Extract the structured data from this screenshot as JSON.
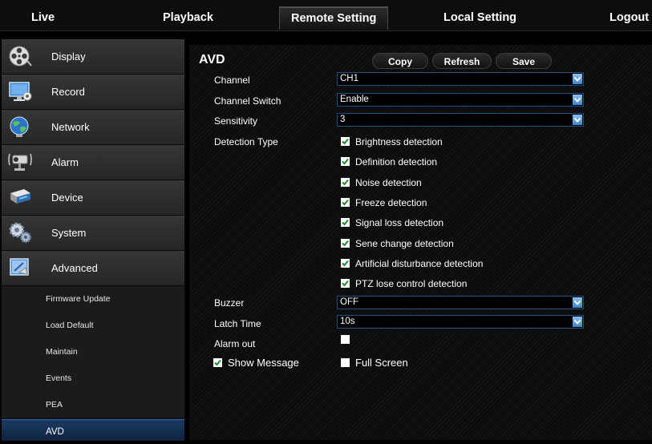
{
  "nav": {
    "tabs": [
      {
        "label": "Live"
      },
      {
        "label": "Playback"
      },
      {
        "label": "Remote Setting"
      },
      {
        "label": "Local Setting"
      },
      {
        "label": "Logout"
      }
    ],
    "active_tab": "Remote Setting"
  },
  "sidebar": {
    "items": [
      {
        "label": "Display",
        "icon": "film-reel-icon"
      },
      {
        "label": "Record",
        "icon": "monitor-record-icon"
      },
      {
        "label": "Network",
        "icon": "globe-icon"
      },
      {
        "label": "Alarm",
        "icon": "camera-alarm-icon"
      },
      {
        "label": "Device",
        "icon": "hard-drive-icon"
      },
      {
        "label": "System",
        "icon": "gears-icon"
      },
      {
        "label": "Advanced",
        "icon": "advanced-settings-icon"
      }
    ],
    "subitems": [
      {
        "label": "Firmware Update"
      },
      {
        "label": "Load Default"
      },
      {
        "label": "Maintain"
      },
      {
        "label": "Events"
      },
      {
        "label": "PEA"
      },
      {
        "label": "AVD"
      }
    ],
    "active_subitem": "AVD"
  },
  "main": {
    "title": "AVD",
    "buttons": {
      "copy": "Copy",
      "refresh": "Refresh",
      "save": "Save"
    },
    "channel": {
      "label": "Channel",
      "value": "CH1"
    },
    "channel_switch": {
      "label": "Channel Switch",
      "value": "Enable"
    },
    "sensitivity": {
      "label": "Sensitivity",
      "value": "3"
    },
    "detection_type": {
      "label": "Detection Type",
      "options": [
        {
          "label": "Brightness detection",
          "checked": true
        },
        {
          "label": "Definition detection",
          "checked": true
        },
        {
          "label": "Noise detection",
          "checked": true
        },
        {
          "label": "Freeze detection",
          "checked": true
        },
        {
          "label": "Signal loss detection",
          "checked": true
        },
        {
          "label": "Sene change detection",
          "checked": true
        },
        {
          "label": "Artificial disturbance detection",
          "checked": true
        },
        {
          "label": "PTZ lose control detection",
          "checked": true
        }
      ]
    },
    "buzzer": {
      "label": "Buzzer",
      "value": "OFF"
    },
    "latch_time": {
      "label": "Latch Time",
      "value": "10s"
    },
    "alarm_out": {
      "label": "Alarm out",
      "checked": false
    },
    "show_message": {
      "label": "Show Message",
      "checked": true
    },
    "full_screen": {
      "label": "Full Screen",
      "checked": false
    }
  },
  "colors": {
    "accent_blue": "#2f6fb3",
    "select_border": "#1c4f86",
    "checkbox_green": "#1f8a2e"
  }
}
